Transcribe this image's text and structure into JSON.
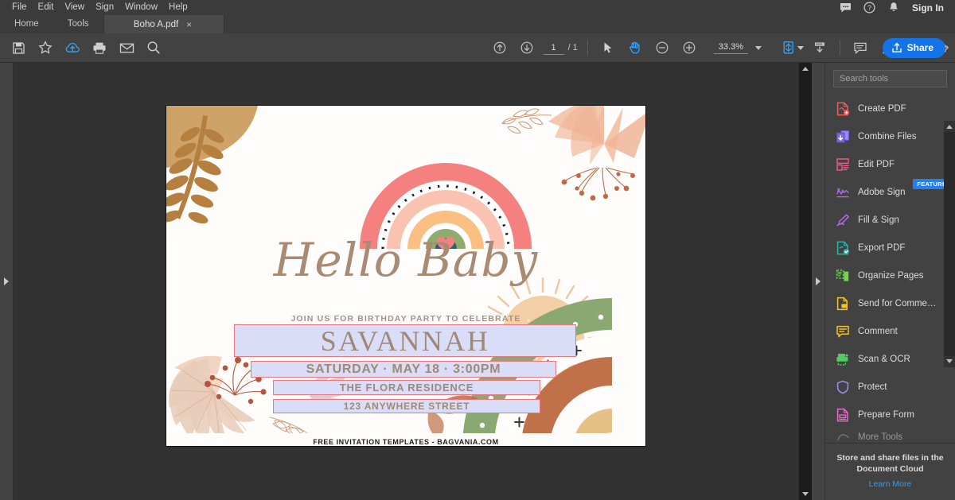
{
  "menubar": {
    "items": [
      "File",
      "Edit",
      "View",
      "Sign",
      "Window",
      "Help"
    ]
  },
  "tabbar": {
    "home_label": "Home",
    "tools_label": "Tools",
    "document_tab": "Boho A.pdf",
    "close_glyph": "×",
    "signin_label": "Sign In",
    "icons": [
      "chat-icon",
      "help-icon",
      "bell-icon"
    ]
  },
  "toolbar": {
    "left_icons": [
      "save-icon",
      "star-icon",
      "cloud-upload-icon",
      "print-icon",
      "email-icon",
      "search-icon"
    ],
    "page_current": "1",
    "page_total": "/ 1",
    "zoom_value": "33.3%",
    "center_icons": [
      "select-cursor-icon",
      "hand-tool-icon",
      "zoom-out-icon",
      "zoom-in-icon"
    ],
    "right_icons": [
      "fit-page-icon",
      "scroll-mode-icon",
      "comment-icon",
      "highlight-icon",
      "draw-icon",
      "sign-icon"
    ],
    "share_label": "Share",
    "share_color": "#1473e6",
    "active_tool_color": "#3aa3f5"
  },
  "tools_panel": {
    "search_placeholder": "Search tools",
    "search_value": "",
    "items": [
      {
        "label": "Create PDF",
        "icon": "create-pdf-icon",
        "color": "#ec5f5f",
        "badge": ""
      },
      {
        "label": "Combine Files",
        "icon": "combine-files-icon",
        "color": "#7b6ae0",
        "badge": ""
      },
      {
        "label": "Edit PDF",
        "icon": "edit-pdf-icon",
        "color": "#f0558d",
        "badge": ""
      },
      {
        "label": "Adobe Sign",
        "icon": "adobe-sign-icon",
        "color": "#b06ae8",
        "badge": "FEATURED"
      },
      {
        "label": "Fill & Sign",
        "icon": "fill-and-sign-icon",
        "color": "#c06ae8",
        "badge": ""
      },
      {
        "label": "Export PDF",
        "icon": "export-pdf-icon",
        "color": "#2bb6a8",
        "badge": ""
      },
      {
        "label": "Organize Pages",
        "icon": "organize-pages-icon",
        "color": "#6fd44e",
        "badge": ""
      },
      {
        "label": "Send for Comme…",
        "icon": "send-for-comments-icon",
        "color": "#f2c233",
        "badge": ""
      },
      {
        "label": "Comment",
        "icon": "comment-icon",
        "color": "#f2c233",
        "badge": ""
      },
      {
        "label": "Scan & OCR",
        "icon": "scan-ocr-icon",
        "color": "#4fce5d",
        "badge": ""
      },
      {
        "label": "Protect",
        "icon": "protect-icon",
        "color": "#9b8cf0",
        "badge": ""
      },
      {
        "label": "Prepare Form",
        "icon": "prepare-form-icon",
        "color": "#e968d0",
        "badge": ""
      },
      {
        "label": "More Tools",
        "icon": "more-tools-icon",
        "color": "#9a9a9a",
        "badge": ""
      }
    ],
    "footer_title": "Store and share files in the Document Cloud",
    "footer_link": "Learn More",
    "footer_link_color": "#3a9ae8"
  },
  "document": {
    "heading_script": "Hello Baby",
    "subheading": "JOIN US FOR BIRTHDAY PARTY TO CELEBRATE",
    "credit": "FREE INVITATION TEMPLATES - BAGVANIA.COM",
    "fields": {
      "name": "SAVANNAH",
      "date": "SATURDAY · MAY 18 ·  3:00PM",
      "venue": "THE FLORA RESIDENCE",
      "address": "123 ANYWHERE STREET"
    },
    "field_fill_color": "#d9ddf7",
    "field_border_color": "#e8787e",
    "palette": {
      "script_brown": "#a98b74",
      "rainbow_coral": "#f4817f",
      "rainbow_blush": "#f7b9a8",
      "rainbow_peach": "#f9bf85",
      "rainbow_green": "#8fab6e",
      "rainbow_teal": "#2f5f70",
      "heart_pink": "#f4817f",
      "tan_blob": "#cfa367",
      "sun_peach": "#f2cfa4",
      "frond_peach": "#efb292",
      "sage_green": "#8aa871",
      "terracotta": "#c0714a"
    }
  }
}
